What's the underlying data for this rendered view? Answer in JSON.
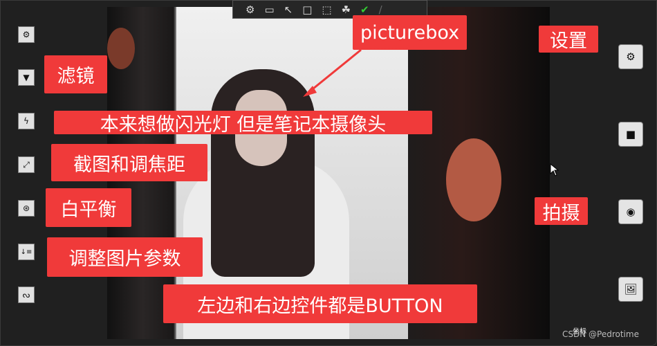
{
  "window": {
    "watermark": "CSDN @Pedrotime",
    "coord_label": "坐标"
  },
  "toolbar": {
    "icons": [
      "video-settings-icon",
      "camera-icon",
      "select-pointer-icon",
      "square-frame-icon",
      "screen-capture-icon",
      "app-icon",
      "check-icon",
      "pen-icon"
    ]
  },
  "left_buttons": [
    {
      "icon": "gear-icon",
      "glyph": "⚙"
    },
    {
      "icon": "filter-icon",
      "glyph": "▼"
    },
    {
      "icon": "flash-icon",
      "glyph": "ϟ"
    },
    {
      "icon": "expand-icon",
      "glyph": "⤢"
    },
    {
      "icon": "white-balance-icon",
      "glyph": "⊛"
    },
    {
      "icon": "sort-icon",
      "glyph": "↓≡"
    },
    {
      "icon": "stumble-icon",
      "glyph": "ᔓ"
    }
  ],
  "right_buttons": [
    {
      "icon": "gear-icon",
      "glyph": "⚙"
    },
    {
      "icon": "video-camera-icon",
      "glyph": "■"
    },
    {
      "icon": "record-icon",
      "glyph": "◉"
    },
    {
      "icon": "image-icon",
      "glyph": "🖼"
    }
  ],
  "annotations": {
    "picturebox": "picturebox",
    "settings": "设置",
    "filter": "滤镜",
    "flash": "本来想做闪光灯 但是笔记本摄像头",
    "screenshot_focus": "截图和调焦距",
    "white_balance": "白平衡",
    "capture": "拍摄",
    "adjust": "调整图片参数",
    "buttons_note": "左边和右边控件都是BUTTON"
  },
  "colors": {
    "annotation": "#f03a3a",
    "background": "#202020"
  }
}
